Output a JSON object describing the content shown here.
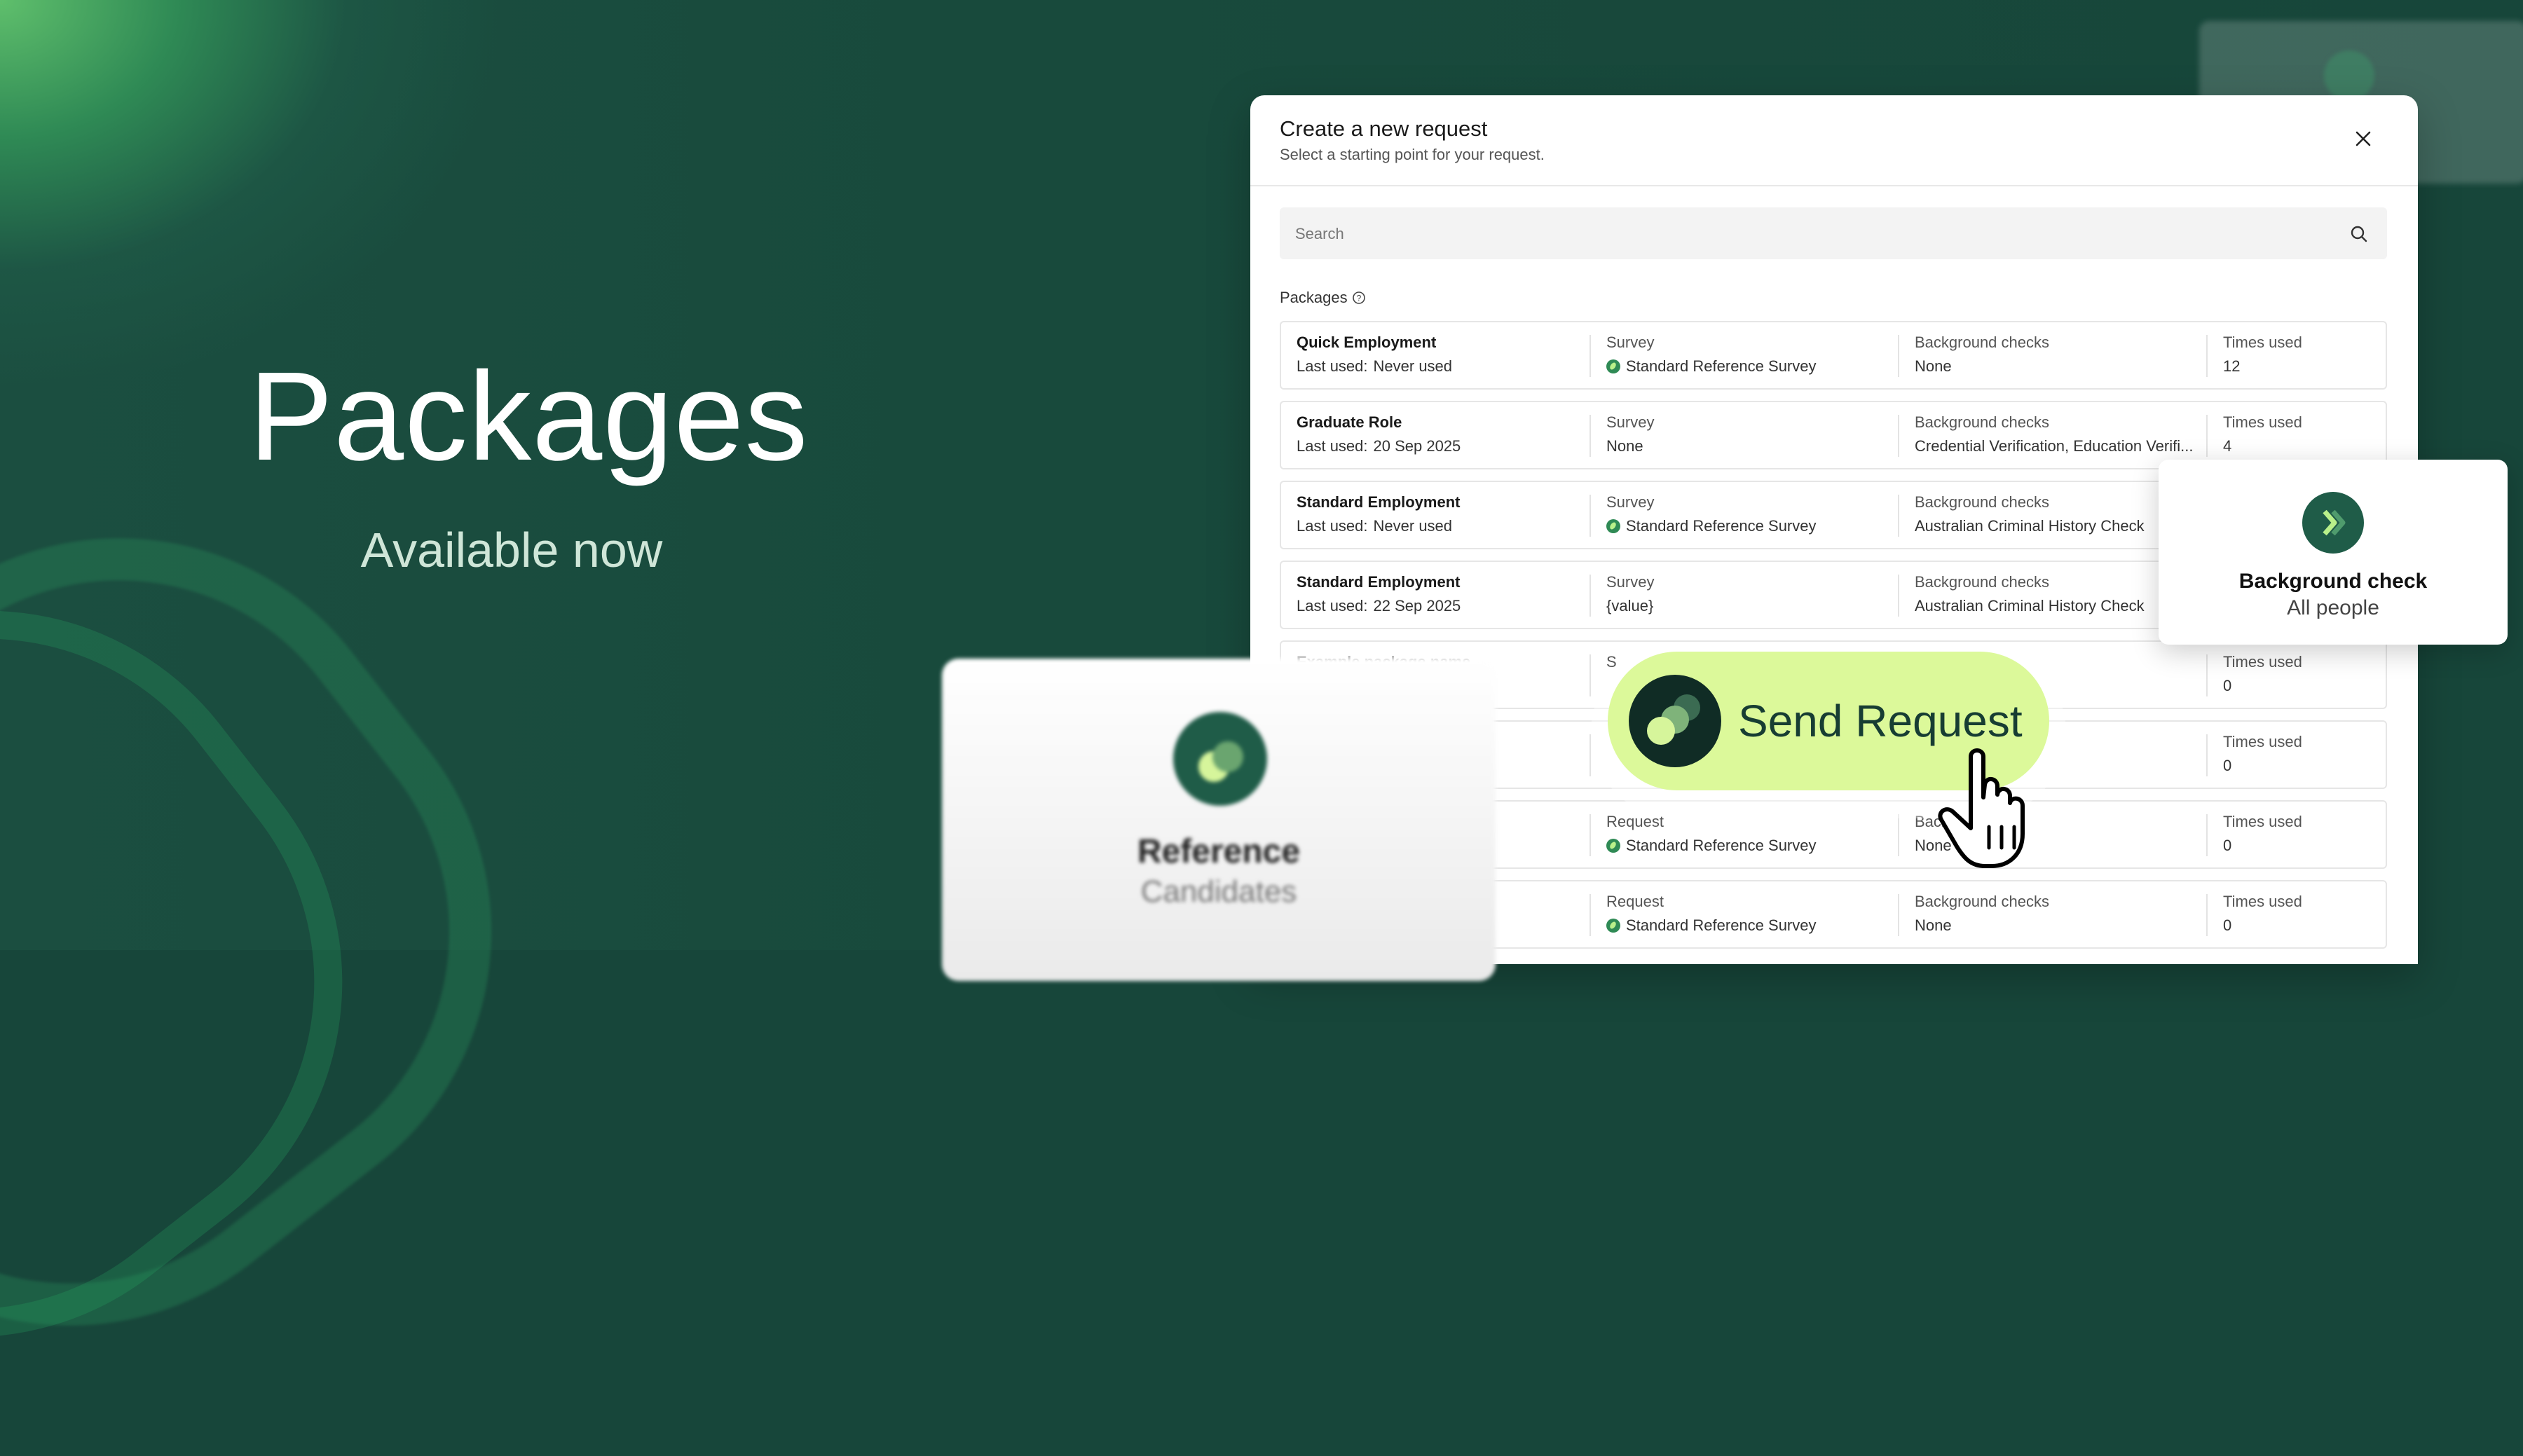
{
  "hero": {
    "title": "Packages",
    "subtitle": "Available now"
  },
  "modal": {
    "title": "Create a new request",
    "subtitle": "Select a starting point for your request.",
    "search_placeholder": "Search",
    "section_label": "Packages",
    "rows": [
      {
        "name": "Quick Employment",
        "last_used_label": "Last used:",
        "last_used": "Never used",
        "survey_label": "Survey",
        "survey": "Standard Reference Survey",
        "survey_icon": true,
        "checks_label": "Background checks",
        "checks": "None",
        "times_label": "Times used",
        "times": "12"
      },
      {
        "name": "Graduate Role",
        "last_used_label": "Last used:",
        "last_used": "20 Sep 2025",
        "survey_label": "Survey",
        "survey": "None",
        "survey_icon": false,
        "checks_label": "Background checks",
        "checks": "Credential Verification, Education Verifi...",
        "times_label": "Times used",
        "times": "4"
      },
      {
        "name": "Standard Employment",
        "last_used_label": "Last used:",
        "last_used": "Never used",
        "survey_label": "Survey",
        "survey": "Standard Reference Survey",
        "survey_icon": true,
        "checks_label": "Background checks",
        "checks": "Australian Criminal History Check",
        "times_label": "Times used",
        "times": ""
      },
      {
        "name": "Standard Employment",
        "last_used_label": "Last used:",
        "last_used": "22 Sep 2025",
        "survey_label": "Survey",
        "survey": "{value}",
        "survey_icon": false,
        "checks_label": "Background checks",
        "checks": "Australian Criminal History Check",
        "times_label": "Times used",
        "times": ""
      },
      {
        "name": "Example package name",
        "last_used_label": "",
        "last_used": "",
        "survey_label": "S",
        "survey": "",
        "survey_icon": false,
        "checks_label": "ks",
        "checks": "",
        "times_label": "Times used",
        "times": "0"
      },
      {
        "name": "",
        "last_used_label": "",
        "last_used": "",
        "survey_label": "",
        "survey": "",
        "survey_icon": false,
        "checks_label": "",
        "checks": "",
        "times_label": "Times used",
        "times": "0"
      },
      {
        "name": "",
        "last_used_label": "",
        "last_used": "",
        "survey_label": "Request",
        "survey": "Standard Reference Survey",
        "survey_icon": true,
        "checks_label": "Backg",
        "checks": "None",
        "times_label": "Times used",
        "times": "0"
      },
      {
        "name": "",
        "last_used_label": "",
        "last_used": "",
        "survey_label": "Request",
        "survey": "Standard Reference Survey",
        "survey_icon": true,
        "checks_label": "Background checks",
        "checks": "None",
        "times_label": "Times used",
        "times": "0"
      }
    ]
  },
  "background_card": {
    "title": "Background check",
    "subtitle": "All people"
  },
  "reference_card": {
    "title": "Reference",
    "subtitle": "Candidates"
  },
  "send_button": {
    "label": "Send Request"
  },
  "colors": {
    "brand_dark": "#17463a",
    "accent_lime": "#dcf99a",
    "brand_green": "#1f5c48"
  },
  "icons": {
    "close": "close-icon",
    "search": "search-icon",
    "help": "help-icon",
    "cursor": "hand-pointer-icon"
  }
}
